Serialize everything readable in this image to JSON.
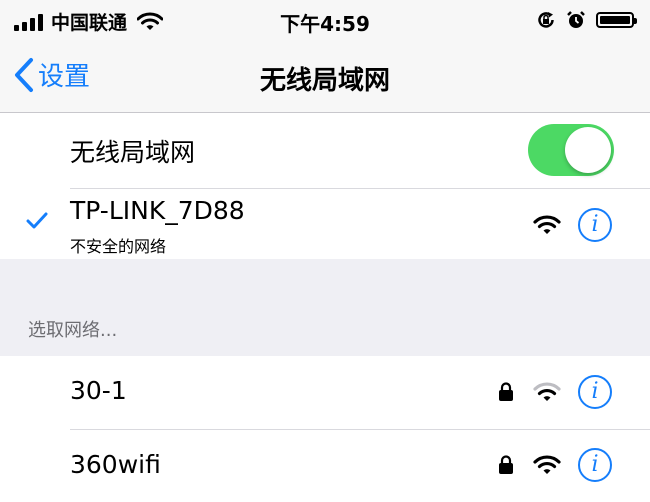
{
  "status_bar": {
    "carrier": "中国联通",
    "time": "下午4:59"
  },
  "nav": {
    "back_label": "设置",
    "title": "无线局域网"
  },
  "wifi_toggle": {
    "label": "无线局域网",
    "on": true,
    "color": "#4cd964"
  },
  "connected_network": {
    "name": "TP-LINK_7D88",
    "subtitle": "不安全的网络",
    "secured": false
  },
  "section_header": "选取网络...",
  "networks": [
    {
      "name": "30-1",
      "locked": true,
      "signal": "weak"
    },
    {
      "name": "360wifi",
      "locked": true,
      "signal": "strong"
    }
  ],
  "colors": {
    "accent": "#157efb",
    "background": "#efeff4"
  }
}
